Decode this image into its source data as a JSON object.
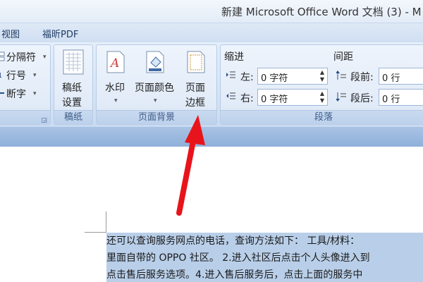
{
  "window": {
    "title": "新建 Microsoft Office Word 文档 (3) - M"
  },
  "tabs": [
    {
      "label": "视图"
    },
    {
      "label": "福昕PDF"
    }
  ],
  "ribbon": {
    "left_partial": {
      "items": [
        {
          "label": "分隔符"
        },
        {
          "label": "行号"
        },
        {
          "label": "断字"
        }
      ]
    },
    "gaozhi": {
      "button_line1": "稿纸",
      "button_line2": "设置",
      "group_label": "稿纸"
    },
    "page_background": {
      "watermark": "水印",
      "page_color": "页面颜色",
      "page_border_line1": "页面",
      "page_border_line2": "边框",
      "group_label": "页面背景"
    },
    "paragraph": {
      "indent_title": "缩进",
      "left_label": "左:",
      "left_value": "0 字符",
      "right_label": "右:",
      "right_value": "0 字符",
      "spacing_title": "间距",
      "before_label": "段前:",
      "before_value": "0 行",
      "after_label": "段后:",
      "after_value": "0 行",
      "group_label": "段落"
    }
  },
  "document": {
    "lines": [
      "还可以查询服务网点的电话，查询方法如下： 工具/材料：",
      "里面自带的 OPPO 社区。 2.进入社区后点击个人头像进入到",
      "点击售后服务选项。4.进入售后服务后，点击上面的服务中"
    ]
  },
  "colors": {
    "annotation_arrow": "#e8141b",
    "selection": "#b9cfe9"
  }
}
